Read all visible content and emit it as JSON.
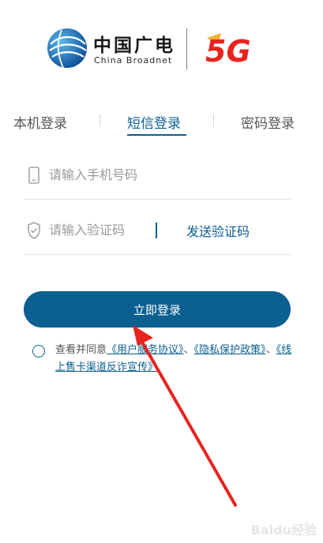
{
  "brand": {
    "name_cn": "中国广电",
    "name_en": "China Broadnet",
    "logo_5g_text": "5G"
  },
  "tabs": [
    {
      "label": "本机登录",
      "active": false
    },
    {
      "label": "短信登录",
      "active": true
    },
    {
      "label": "密码登录",
      "active": false
    }
  ],
  "form": {
    "phone_placeholder": "请输入手机号码",
    "code_placeholder": "请输入验证码",
    "send_code_label": "发送验证码",
    "login_label": "立即登录"
  },
  "agreement": {
    "prefix": "查看并同意",
    "link1": "《用户服务协议》",
    "sep1": "、",
    "link2": "《隐私保护政策》",
    "sep2": "、",
    "link3": "《线上售卡渠道反诈宣传》"
  },
  "watermark": "Baidu经验",
  "colors": {
    "primary": "#0b5f91",
    "arrow": "#e8231d"
  }
}
